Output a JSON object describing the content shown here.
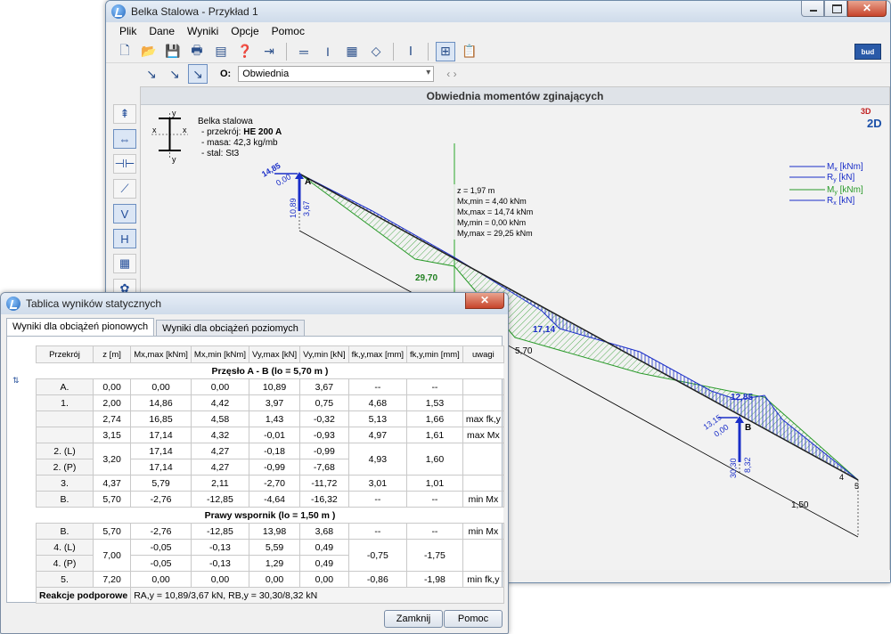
{
  "main_window": {
    "title": "Belka Stalowa - Przykład 1",
    "menu": [
      "Plik",
      "Dane",
      "Wyniki",
      "Opcje",
      "Pomoc"
    ],
    "combo_label": "O:",
    "combo_value": "Obwiednia",
    "logo": "bud",
    "canvas_title": "Obwiednia momentów zginających",
    "view_toggle": {
      "top": "3D",
      "main": "2D"
    },
    "beam_info": {
      "title": "Belka stalowa",
      "line1_label": "- przekrój:",
      "line1_value": "HE 200 A",
      "line2": "- masa: 42,3 kg/mb",
      "line3": "- stal: St3"
    },
    "section_axes": {
      "x": "x",
      "y": "y"
    },
    "legend": [
      {
        "main": "M",
        "sub": "x",
        "unit": "[kNm]",
        "color": "#1a2ec8"
      },
      {
        "main": "R",
        "sub": "y",
        "unit": "[kN]",
        "color": "#1a2ec8"
      },
      {
        "main": "M",
        "sub": "y",
        "unit": "[kNm]",
        "color": "#2a9a2a"
      },
      {
        "main": "R",
        "sub": "x",
        "unit": "[kN]",
        "color": "#1a2ec8"
      }
    ],
    "cursor_info": [
      "z = 1,97 m",
      "Mx,min = 4,40 kNm",
      "Mx,max = 14,74 kNm",
      "My,min = 0,00 kNm",
      "My,max = 29,25 kNm"
    ],
    "diagram_labels": {
      "support_a": "A",
      "support_b": "B",
      "a_rx": "14,85",
      "a_rx2": "0,00",
      "a_ry": "10,89",
      "a_ry2": "3,67",
      "b_rx": "13,15",
      "b_rx2": "0,00",
      "b_ry": "30,30",
      "b_ry2": "8,32",
      "my_peak": "29,70",
      "mx_mid": "17,14",
      "mx_b": "12,85",
      "dim_span": "5,70",
      "dim_cant": "1,50",
      "node4": "4",
      "node5": "5"
    }
  },
  "dialog": {
    "title": "Tablica wyników statycznych",
    "tabs": [
      "Wyniki dla obciążeń pionowych",
      "Wyniki dla obciążeń poziomych"
    ],
    "headers": [
      "Przekrój",
      "z [m]",
      "Mx,max [kNm]",
      "Mx,min [kNm]",
      "Vy,max [kN]",
      "Vy,min [kN]",
      "fk,y,max [mm]",
      "fk,y,min [mm]",
      "uwagi"
    ],
    "section1": "Przęsło A - B  (lo = 5,70 m )",
    "section2": "Prawy wspornik  (lo = 1,50 m )",
    "rows1": [
      [
        "A.",
        "0,00",
        "0,00",
        "0,00",
        "10,89",
        "3,67",
        "--",
        "--",
        ""
      ],
      [
        "1.",
        "2,00",
        "14,86",
        "4,42",
        "3,97",
        "0,75",
        "4,68",
        "1,53",
        ""
      ],
      [
        "",
        "2,74",
        "16,85",
        "4,58",
        "1,43",
        "-0,32",
        "5,13",
        "1,66",
        "max fk,y"
      ],
      [
        "",
        "3,15",
        "17,14",
        "4,32",
        "-0,01",
        "-0,93",
        "4,97",
        "1,61",
        "max Mx"
      ]
    ],
    "split1": {
      "labels": [
        "2. (L)",
        "2. (P)"
      ],
      "z": "3,20",
      "a": [
        "17,14",
        "4,27",
        "-0,18",
        "-0,99"
      ],
      "b": [
        "17,14",
        "4,27",
        "-0,99",
        "-7,68"
      ],
      "f": [
        "4,93",
        "1,60"
      ],
      "note": ""
    },
    "rows2": [
      [
        "3.",
        "4,37",
        "5,79",
        "2,11",
        "-2,70",
        "-11,72",
        "3,01",
        "1,01",
        ""
      ],
      [
        "B.",
        "5,70",
        "-2,76",
        "-12,85",
        "-4,64",
        "-16,32",
        "--",
        "--",
        "min Mx"
      ]
    ],
    "rows3": [
      [
        "B.",
        "5,70",
        "-2,76",
        "-12,85",
        "13,98",
        "3,68",
        "--",
        "--",
        "min Mx"
      ]
    ],
    "split2": {
      "labels": [
        "4. (L)",
        "4. (P)"
      ],
      "z": "7,00",
      "a": [
        "-0,05",
        "-0,13",
        "5,59",
        "0,49"
      ],
      "b": [
        "-0,05",
        "-0,13",
        "1,29",
        "0,49"
      ],
      "f": [
        "-0,75",
        "-1,75"
      ],
      "note": ""
    },
    "rows4": [
      [
        "5.",
        "7,20",
        "0,00",
        "0,00",
        "0,00",
        "0,00",
        "-0,86",
        "-1,98",
        "min fk,y"
      ]
    ],
    "reactions_label": "Reakcje podporowe",
    "reactions_value": "RA,y = 10,89/3,67 kN, RB,y = 30,30/8,32 kN",
    "buttons": [
      "Zamknij",
      "Pomoc"
    ]
  }
}
